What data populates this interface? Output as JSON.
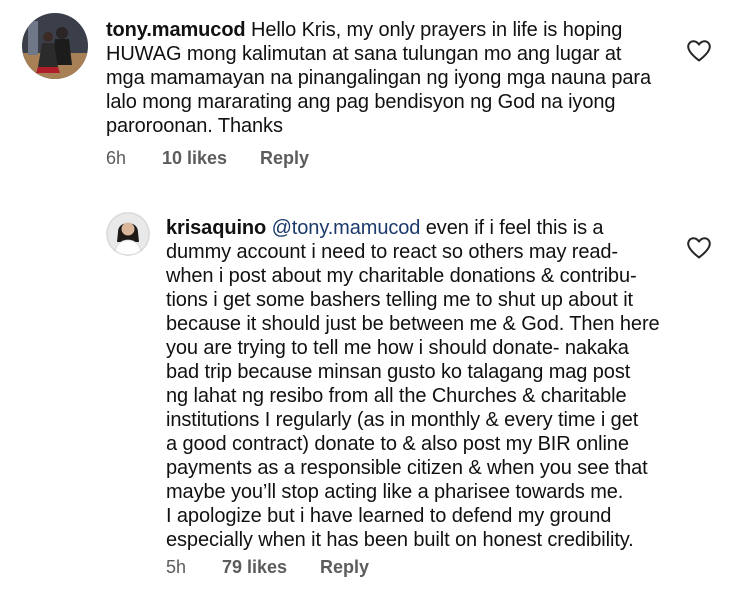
{
  "comments": [
    {
      "username": "tony.mamucod",
      "lines": [
        "Hello Kris, my only prayers in life is hoping",
        "HUWAG mong kalimutan at sana tulungan mo ang lugar at",
        "mga mamamayan na pinangalingan ng iyong mga nauna para",
        "lalo mong mararating ang pag bendisyon ng God na iyong",
        "paroroonan. Thanks"
      ],
      "time": "6h",
      "likes": "10 likes",
      "reply": "Reply"
    },
    {
      "username": "krisaquino",
      "mention": "@tony.mamucod",
      "lines": [
        " even if i feel this is a",
        "dummy account i need to react so others may read-",
        "when i post about my charitable donations & contribu-",
        "tions i get some bashers telling me to shut up about it",
        "because it should just be between me & God. Then here",
        "you are trying to tell me how i should donate- nakaka",
        "bad trip because minsan gusto ko talagang mag post",
        "ng lahat ng resibo from all the Churches & charitable",
        "institutions I regularly (as in monthly & every time i get",
        "a good contract) donate to & also post my BIR online",
        "payments as a responsible citizen & when you see that",
        "maybe you’ll stop acting like a pharisee towards me.",
        "I apologize but i have learned to defend my ground",
        "especially when it has been built on honest credibility."
      ],
      "time": "5h",
      "likes": "79 likes",
      "reply": "Reply"
    }
  ],
  "icons": {
    "like": "heart-outline-icon"
  },
  "colors": {
    "text": "#111111",
    "meta": "#5c5c5c",
    "mention": "#1a3a6b"
  }
}
